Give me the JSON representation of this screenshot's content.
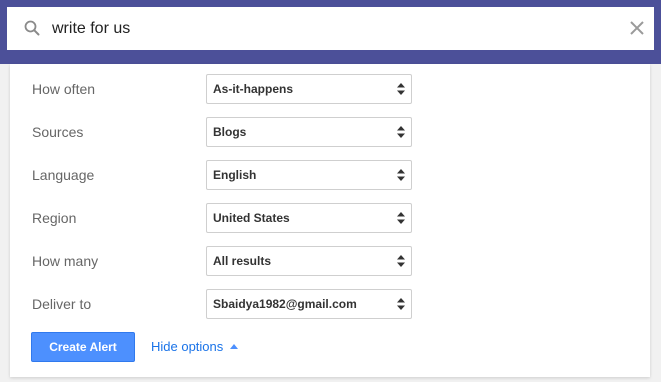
{
  "search": {
    "query": "write for us"
  },
  "options": [
    {
      "label": "How often",
      "value": "As-it-happens"
    },
    {
      "label": "Sources",
      "value": "Blogs"
    },
    {
      "label": "Language",
      "value": "English"
    },
    {
      "label": "Region",
      "value": "United States"
    },
    {
      "label": "How many",
      "value": "All results"
    },
    {
      "label": "Deliver to",
      "value": "Sbaidya1982@gmail.com"
    }
  ],
  "actions": {
    "create_label": "Create Alert",
    "hide_options_label": "Hide options"
  },
  "colors": {
    "header_band": "#4c5099",
    "primary_button": "#4d90fe",
    "link": "#1a73e8"
  }
}
